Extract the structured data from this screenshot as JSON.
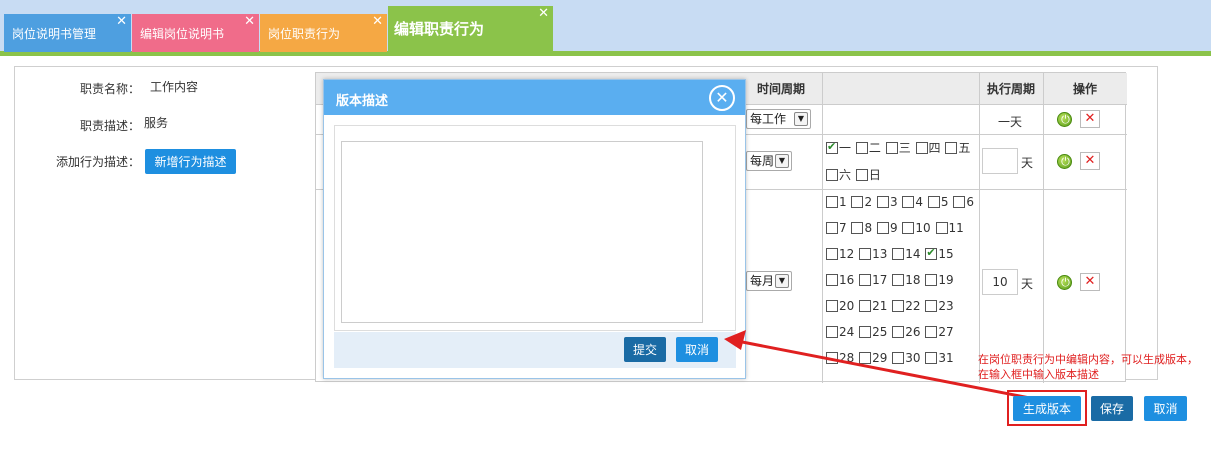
{
  "tabs": [
    {
      "label": "岗位说明书管理",
      "close": "✕"
    },
    {
      "label": "编辑岗位说明书",
      "close": "✕"
    },
    {
      "label": "岗位职责行为",
      "close": "✕"
    },
    {
      "label": "编辑职责行为",
      "close": "✕"
    }
  ],
  "form": {
    "name_label": "职责名称：",
    "name_value": "工作内容",
    "desc_label": "职责描述：",
    "desc_value": "服务",
    "add_label": "添加行为描述：",
    "add_button": "新增行为描述"
  },
  "table": {
    "headers": {
      "time_period": "时间周期",
      "exec_period": "执行周期",
      "operation": "操作"
    },
    "rows": [
      {
        "period": "每工作",
        "exec_text": "一天"
      },
      {
        "period": "每周",
        "exec_value": "",
        "unit": "天",
        "weekdays_line1": [
          "一",
          "二",
          "三",
          "四",
          "五"
        ],
        "weekdays_line2": [
          "六",
          "日"
        ]
      },
      {
        "period": "每月",
        "exec_value": "10",
        "unit": "天",
        "days": [
          [
            "1",
            "2",
            "3",
            "4",
            "5",
            "6"
          ],
          [
            "7",
            "8",
            "9",
            "10",
            "11"
          ],
          [
            "12",
            "13",
            "14",
            "15"
          ],
          [
            "16",
            "17",
            "18",
            "19"
          ],
          [
            "20",
            "21",
            "22",
            "23"
          ],
          [
            "24",
            "25",
            "26",
            "27"
          ],
          [
            "28",
            "29",
            "30",
            "31"
          ]
        ]
      }
    ],
    "checked_weekday": "一",
    "checked_day": "15"
  },
  "modal": {
    "title": "版本描述",
    "close": "✕",
    "textarea_value": "",
    "submit": "提交",
    "cancel": "取消"
  },
  "annotation": "在岗位职责行为中编辑内容，可以生成版本，在输入框中输入版本描述",
  "actions": {
    "generate": "生成版本",
    "save": "保存",
    "cancel": "取消"
  },
  "colors": {
    "tab1": "#4e9fe0",
    "tab2": "#f06c8a",
    "tab3": "#f5a844",
    "tab4": "#8bc34a",
    "annotation_red": "#e02020",
    "button_blue": "#1e8fe0"
  }
}
